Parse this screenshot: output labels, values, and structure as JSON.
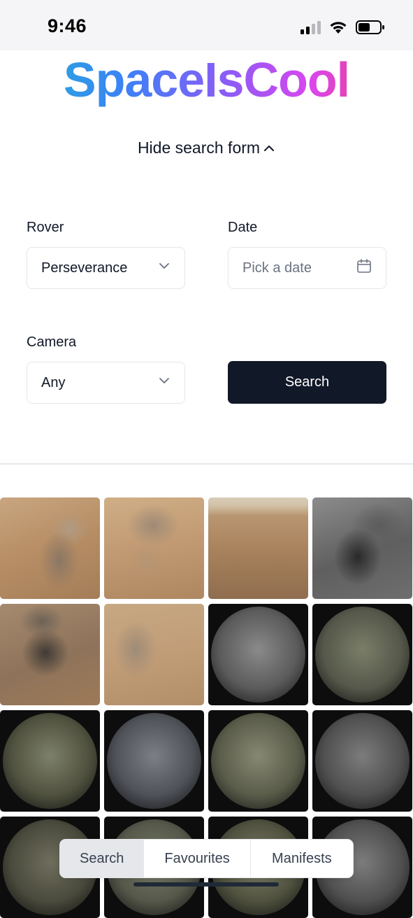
{
  "status_bar": {
    "time": "9:46"
  },
  "header": {
    "logo": "SpaceIsCool",
    "toggle_label": "Hide search form"
  },
  "form": {
    "rover_label": "Rover",
    "rover_value": "Perseverance",
    "date_label": "Date",
    "date_placeholder": "Pick a date",
    "camera_label": "Camera",
    "camera_value": "Any",
    "search_button": "Search"
  },
  "gallery": {
    "photos": [
      {
        "tone": "tan1"
      },
      {
        "tone": "tan2"
      },
      {
        "tone": "tan3"
      },
      {
        "tone": "gray1"
      },
      {
        "tone": "tan4"
      },
      {
        "tone": "tan5"
      },
      {
        "tone": "g1"
      },
      {
        "tone": "g2"
      },
      {
        "tone": "g3"
      },
      {
        "tone": "g4"
      },
      {
        "tone": "g5"
      },
      {
        "tone": "g6"
      },
      {
        "tone": "g7"
      },
      {
        "tone": "g2"
      },
      {
        "tone": "g3"
      },
      {
        "tone": "g6"
      }
    ]
  },
  "tabbar": {
    "tabs": [
      {
        "label": "Search",
        "active": true
      },
      {
        "label": "Favourites",
        "active": false
      },
      {
        "label": "Manifests",
        "active": false
      }
    ]
  },
  "colors": {
    "primary_button": "#111827",
    "border": "#e5e7eb",
    "logo_gradient": [
      "#22b8cf",
      "#3b82f6",
      "#8b5cf6",
      "#d946ef",
      "#f43f5e"
    ]
  }
}
